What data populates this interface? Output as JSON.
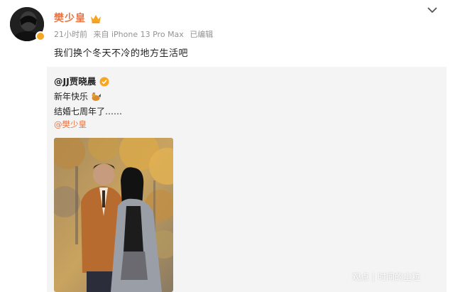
{
  "post": {
    "author": "樊少皇",
    "time": "21小时前",
    "source": "来自 iPhone 13 Pro Max",
    "edited": "已编辑",
    "text": "我们换个冬天不冷的地方生活吧"
  },
  "repost": {
    "author": "@JJ贾晓晨",
    "line1": "新年快乐",
    "line2": "结婚七周年了……",
    "mention": "@樊少皇"
  },
  "watermark": {
    "left": "观点",
    "right": "时间的尘粒"
  },
  "colors": {
    "accent": "#eb7340",
    "meta": "#939393",
    "repost_bg": "#f4f4f4"
  },
  "icons": [
    "crown-icon",
    "verified-icon",
    "chevron-down-icon",
    "rooster-icon"
  ]
}
